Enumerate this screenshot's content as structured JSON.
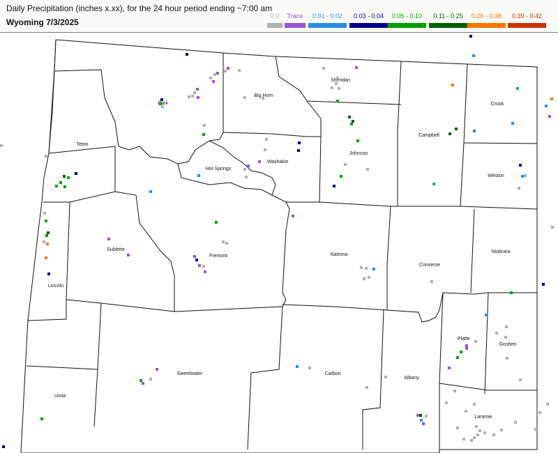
{
  "header": {
    "title": "Daily Precipitation (inches  x.xx),  for the 24 hour period ending ~7:00 am",
    "subtitle": "Wyoming 7/3/2025"
  },
  "legend": [
    {
      "label": "0.0",
      "color": "#b0b0b0"
    },
    {
      "label": "Trace",
      "color": "#9a55d2"
    },
    {
      "label": "0.01 - 0.02",
      "color": "#2a8ee8"
    },
    {
      "label": "0.03 - 0.04",
      "color": "#000088"
    },
    {
      "label": "0.05 - 0.10",
      "color": "#00a000"
    },
    {
      "label": "0.11 - 0.25",
      "color": "#006000"
    },
    {
      "label": "0.26 - 0.38",
      "color": "#ff7700"
    },
    {
      "label": "0.39 - 0.42",
      "color": "#cc3300"
    }
  ],
  "counties": [
    {
      "name": "Park"
    },
    {
      "name": "Big Horn"
    },
    {
      "name": "Sheridan"
    },
    {
      "name": "Campbell"
    },
    {
      "name": "Crook"
    },
    {
      "name": "Teton"
    },
    {
      "name": "Johnson"
    },
    {
      "name": "Washakie"
    },
    {
      "name": "Hot Springs"
    },
    {
      "name": "Weston"
    },
    {
      "name": "Sublette"
    },
    {
      "name": "Fremont"
    },
    {
      "name": "Natrona"
    },
    {
      "name": "Converse"
    },
    {
      "name": "Niobrara"
    },
    {
      "name": "Lincoln"
    },
    {
      "name": "Platte"
    },
    {
      "name": "Goshen"
    },
    {
      "name": "Sweetwater"
    },
    {
      "name": "Carbon"
    },
    {
      "name": "Albany"
    },
    {
      "name": "Uinta"
    },
    {
      "name": "Laramie"
    }
  ]
}
